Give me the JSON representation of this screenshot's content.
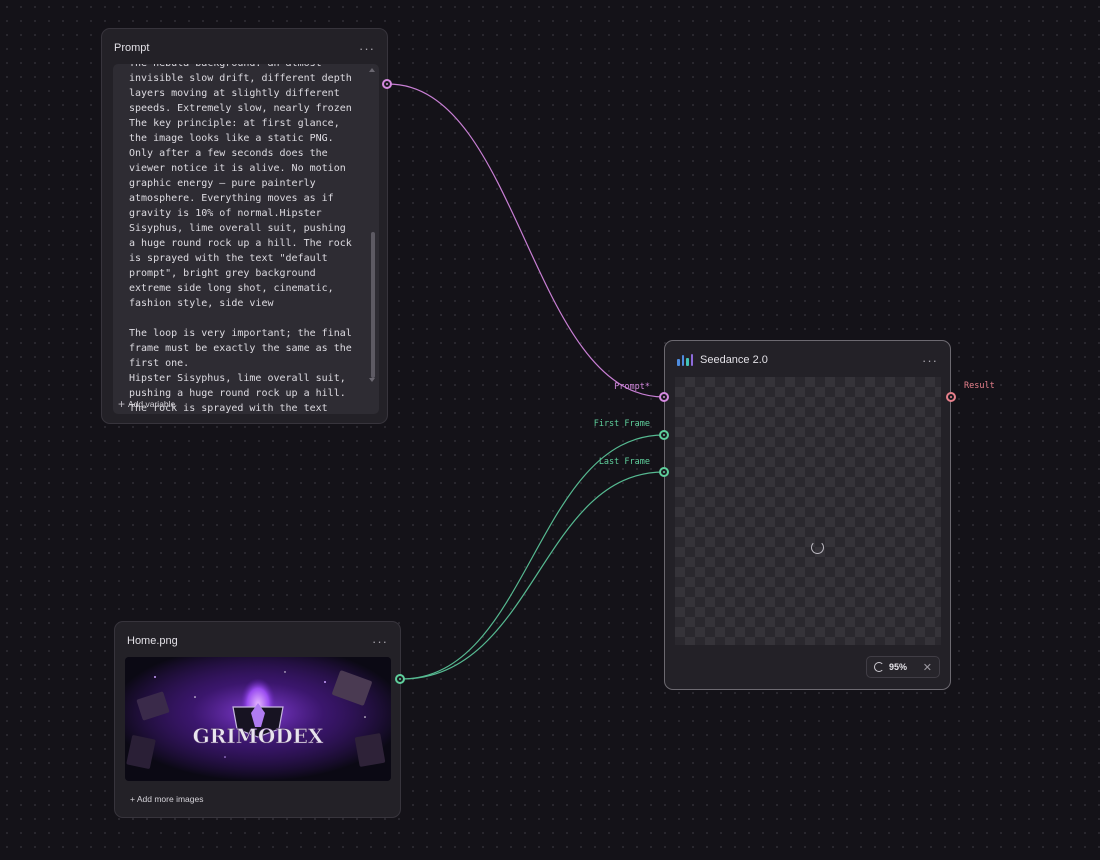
{
  "prompt_node": {
    "title": "Prompt",
    "menu": "···",
    "text": "The nebula background: an almost invisible slow drift, different depth layers moving at slightly different speeds. Extremely slow, nearly frozen\nThe key principle: at first glance, the image looks like a static PNG. Only after a few seconds does the viewer notice it is alive. No motion graphic energy — pure painterly atmosphere. Everything moves as if gravity is 10% of normal.Hipster Sisyphus, lime overall suit, pushing a huge round rock up a hill. The rock is sprayed with the text \"default prompt\", bright grey background extreme side long shot, cinematic, fashion style, side view\n\nThe loop is very important; the final frame must be exactly the same as the first one.\nHipster Sisyphus, lime overall suit, pushing a huge round rock up a hill. The rock is sprayed with the text \"default prompt\", bright grey background extreme side long shot, cinematic, fashion style, side view",
    "add_variable": "Add variable",
    "add_symbol": "+"
  },
  "seedance_node": {
    "title": "Seedance 2.0",
    "menu": "···",
    "inputs": [
      "Prompt*",
      "First Frame",
      "Last Frame"
    ],
    "output": "Result",
    "progress": "95%",
    "progress_value": 95,
    "cancel_symbol": "✕"
  },
  "home_node": {
    "title": "Home.png",
    "menu": "···",
    "image_text": "GRIMODEX",
    "add_images": "+ Add more images"
  },
  "colors": {
    "prompt_wire": "#c87fd4",
    "image_wire": "#56b991",
    "result_port": "#e8808c",
    "brand_bars": [
      "#4f8de0",
      "#42c4b7",
      "#8d6bdb"
    ]
  }
}
